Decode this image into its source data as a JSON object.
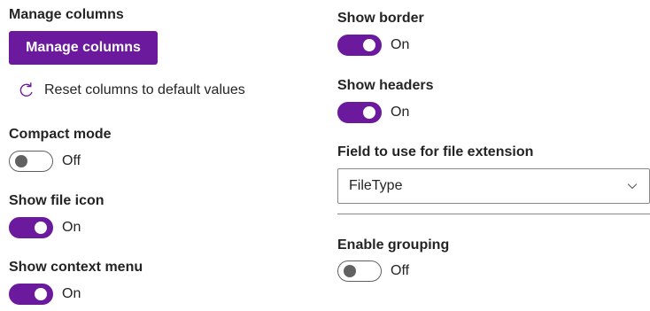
{
  "left": {
    "manage_columns": {
      "label": "Manage columns",
      "button_label": "Manage columns",
      "reset_label": "Reset columns to default values"
    },
    "compact_mode": {
      "label": "Compact mode",
      "state": "Off"
    },
    "show_file_icon": {
      "label": "Show file icon",
      "state": "On"
    },
    "show_context_menu": {
      "label": "Show context menu",
      "state": "On"
    }
  },
  "right": {
    "show_border": {
      "label": "Show border",
      "state": "On"
    },
    "show_headers": {
      "label": "Show headers",
      "state": "On"
    },
    "file_extension_field": {
      "label": "Field to use for file extension",
      "selected": "FileType"
    },
    "enable_grouping": {
      "label": "Enable grouping",
      "state": "Off"
    }
  },
  "colors": {
    "accent": "#6b1a9e",
    "toggle_off": "#616161",
    "text": "#242424",
    "border": "#8a8a8a"
  },
  "icons": {
    "reset": "refresh-icon",
    "dropdown": "chevron-down-icon"
  }
}
